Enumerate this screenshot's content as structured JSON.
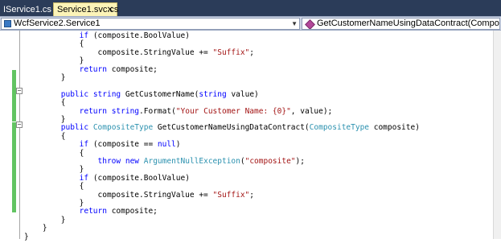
{
  "tabs": [
    {
      "label": "IService1.cs",
      "icon": "pin-icon",
      "active": false
    },
    {
      "label": "Service1.svc.cs",
      "icon": "close-icon",
      "active": true
    }
  ],
  "nav": {
    "type_combo": "WcfService2.Service1",
    "member_combo": "GetCustomerNameUsingDataContract(CompositeType composite)"
  },
  "colors": {
    "tab_strip": "#2b3c59",
    "active_tab": "#fcf4b8",
    "keyword": "#0000ff",
    "type": "#2b91af",
    "string": "#a31515",
    "change_bar": "#62c462"
  },
  "code_lines": [
    [
      {
        "t": "            "
      },
      {
        "k": "kw",
        "t": "if"
      },
      {
        "t": " (composite.BoolValue)"
      }
    ],
    [
      {
        "t": "            {"
      }
    ],
    [
      {
        "t": "                composite.StringValue += "
      },
      {
        "k": "st",
        "t": "\"Suffix\""
      },
      {
        "t": ";"
      }
    ],
    [
      {
        "t": "            }"
      }
    ],
    [
      {
        "t": "            "
      },
      {
        "k": "kw",
        "t": "return"
      },
      {
        "t": " composite;"
      }
    ],
    [
      {
        "t": "        }"
      }
    ],
    [
      {
        "t": ""
      }
    ],
    [
      {
        "t": "        "
      },
      {
        "k": "kw",
        "t": "public"
      },
      {
        "t": " "
      },
      {
        "k": "kw",
        "t": "string"
      },
      {
        "t": " GetCustomerName("
      },
      {
        "k": "kw",
        "t": "string"
      },
      {
        "t": " value)"
      }
    ],
    [
      {
        "t": "        {"
      }
    ],
    [
      {
        "t": "            "
      },
      {
        "k": "kw",
        "t": "return"
      },
      {
        "t": " "
      },
      {
        "k": "kw",
        "t": "string"
      },
      {
        "t": ".Format("
      },
      {
        "k": "st",
        "t": "\"Your Customer Name: {0}\""
      },
      {
        "t": ", value);"
      }
    ],
    [
      {
        "t": "        }"
      }
    ],
    [
      {
        "t": "        "
      },
      {
        "k": "kw",
        "t": "public"
      },
      {
        "t": " "
      },
      {
        "k": "ty",
        "t": "CompositeType"
      },
      {
        "t": " GetCustomerNameUsingDataContract("
      },
      {
        "k": "ty",
        "t": "CompositeType"
      },
      {
        "t": " composite)"
      }
    ],
    [
      {
        "t": "        {"
      }
    ],
    [
      {
        "t": "            "
      },
      {
        "k": "kw",
        "t": "if"
      },
      {
        "t": " (composite == "
      },
      {
        "k": "kw",
        "t": "null"
      },
      {
        "t": ")"
      }
    ],
    [
      {
        "t": "            {"
      }
    ],
    [
      {
        "t": "                "
      },
      {
        "k": "kw",
        "t": "throw"
      },
      {
        "t": " "
      },
      {
        "k": "kw",
        "t": "new"
      },
      {
        "t": " "
      },
      {
        "k": "ty",
        "t": "ArgumentNullException"
      },
      {
        "t": "("
      },
      {
        "k": "st",
        "t": "\"composite\""
      },
      {
        "t": ");"
      }
    ],
    [
      {
        "t": "            }"
      }
    ],
    [
      {
        "t": "            "
      },
      {
        "k": "kw",
        "t": "if"
      },
      {
        "t": " (composite.BoolValue)"
      }
    ],
    [
      {
        "t": "            {"
      }
    ],
    [
      {
        "t": "                composite.StringValue += "
      },
      {
        "k": "st",
        "t": "\"Suffix\""
      },
      {
        "t": ";"
      }
    ],
    [
      {
        "t": "            }"
      }
    ],
    [
      {
        "t": "            "
      },
      {
        "k": "kw",
        "t": "return"
      },
      {
        "t": " composite;"
      }
    ],
    [
      {
        "t": "        }"
      }
    ],
    [
      {
        "t": "    }"
      }
    ],
    [
      {
        "t": "}"
      }
    ]
  ]
}
